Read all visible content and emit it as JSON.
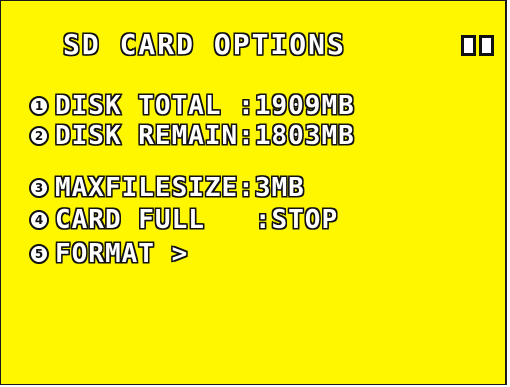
{
  "title": "SD CARD OPTIONS",
  "colors": {
    "background": "#fff700",
    "text_fill": "#ffffff",
    "text_outline": "#111111"
  },
  "menu": {
    "items": [
      {
        "number": "1",
        "label": "DISK TOTAL :1909MB"
      },
      {
        "number": "2",
        "label": "DISK REMAIN:1803MB"
      },
      {
        "number": "3",
        "label": "MAXFILESIZE:3MB"
      },
      {
        "number": "4",
        "label": "CARD FULL   :STOP"
      },
      {
        "number": "5",
        "label": "FORMAT >"
      }
    ]
  }
}
